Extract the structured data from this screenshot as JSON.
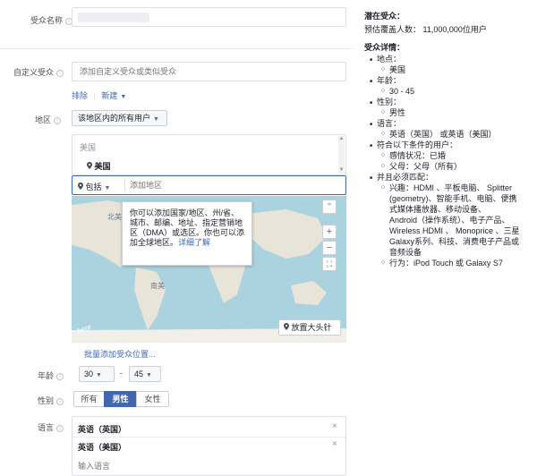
{
  "left": {
    "audience_name": {
      "label": "受众名称"
    },
    "custom_audience": {
      "label": "自定义受众",
      "placeholder": "添加自定义受众或类似受众",
      "exclude": "排除",
      "create": "新建"
    },
    "location": {
      "label": "地区",
      "scope_dropdown": "该地区内的所有用户",
      "group_header": "美国",
      "selected_item": "美国",
      "include_dropdown": "包括",
      "search_placeholder": "添加地区",
      "tooltip": "你可以添加国家/地区、州/省、城市、邮编、地址、指定营销地区（DMA）或选区。你也可以添加全球地区。",
      "tooltip_link": "详细了解",
      "pin_button": "放置大头针",
      "bulk_link": "批量添加受众位置..."
    },
    "age": {
      "label": "年龄",
      "min": "30",
      "dash": "-",
      "max": "45"
    },
    "gender": {
      "label": "性别",
      "options": [
        "所有",
        "男性",
        "女性"
      ],
      "selected": "男性"
    },
    "language": {
      "label": "语言",
      "items": [
        "英语（英国）",
        "英语（美国）"
      ],
      "placeholder": "输入语言"
    }
  },
  "right": {
    "potential_title": "潜在受众：",
    "potential_reach": "预估覆盖人数： 11,000,000位用户",
    "details_title": "受众详情：",
    "location_label": "地点：",
    "location_value": "美国",
    "age_label": "年龄：",
    "age_value": "30 - 45",
    "gender_label": "性别：",
    "gender_value": "男性",
    "language_label": "语言：",
    "language_value": "英语（英国） 或英语（美国）",
    "match_any_label": "符合以下条件的用户：",
    "match_any_items": [
      "感情状况：已婚",
      "父母：父母（所有）"
    ],
    "match_all_label": "并且必须匹配：",
    "interest_line1": "兴趣：HDMI 、平板电脑、 Splitter",
    "interest_line2": "(geometry)、智能手机、电脑、便携",
    "interest_line3": "式媒体播放器、移动设备、",
    "interest_line4": "Android（操作系统）、电子产品、",
    "interest_line5": "Wireless HDMI 、 Monoprice 、三星",
    "interest_line6": "Galaxy系列、科技、消费电子产品或",
    "interest_line7": "音频设备",
    "behavior": "行为：iPod Touch 或 Galaxy S7"
  },
  "colors": {
    "accent": "#4267b2",
    "selected_segment": "#4267b2",
    "map_water": "#aad3df",
    "map_land": "#e8e4d8"
  }
}
